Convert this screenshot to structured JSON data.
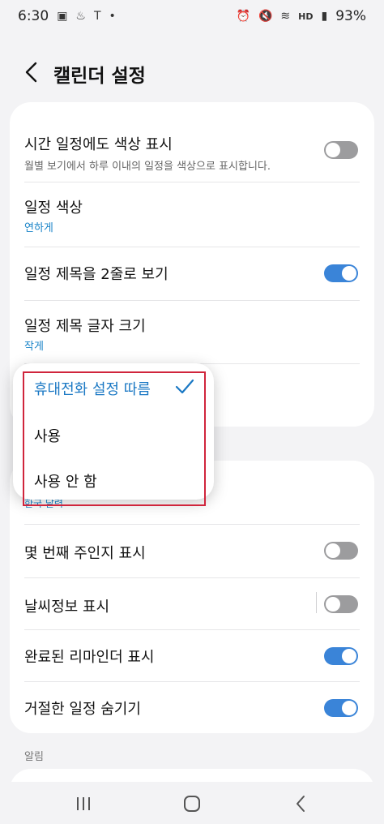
{
  "status_bar": {
    "time": "6:30",
    "signal_label": "HD",
    "battery": "93%"
  },
  "header": {
    "title": "캘린더 설정"
  },
  "card1": {
    "rows": [
      {
        "title": "시간 일정에도 색상 표시",
        "subtitle": "월별 보기에서 하루 이내의 일정을 색상으로 표시합니다.",
        "toggle": false
      },
      {
        "title": "일정 색상",
        "value": "연하게"
      },
      {
        "title": "일정 제목을 2줄로 보기",
        "toggle": true
      },
      {
        "title": "일정 제목 글자 크기",
        "value": "작게"
      }
    ]
  },
  "popup": {
    "options": [
      {
        "label": "휴대전화 설정 따름",
        "selected": true
      },
      {
        "label": "사용",
        "selected": false
      },
      {
        "label": "사용 안 함",
        "selected": false
      }
    ],
    "peek_text": "한국 달력"
  },
  "card2": {
    "rows": [
      {
        "title": "몇 번째 주인지 표시",
        "toggle": false
      },
      {
        "title": "날씨정보 표시",
        "toggle": false
      },
      {
        "title": "완료된 리마인더 표시",
        "toggle": true
      },
      {
        "title": "거절한 일정 숨기기",
        "toggle": true
      }
    ]
  },
  "section": {
    "alerts_label": "알림"
  },
  "colors": {
    "accent": "#3a84d8",
    "link": "#1a84c8",
    "highlight": "#d0253c"
  }
}
